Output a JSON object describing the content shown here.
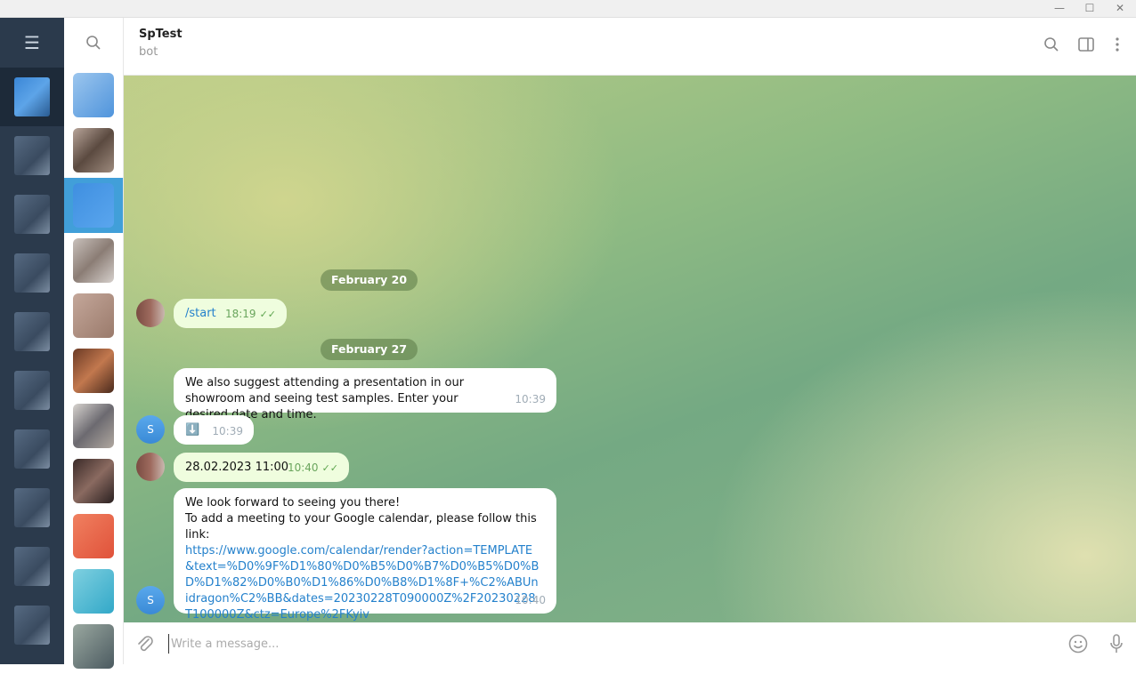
{
  "window": {
    "minimize": "—",
    "maximize": "☐",
    "close": "✕"
  },
  "header": {
    "title": "SpTest",
    "subtitle": "bot"
  },
  "messages": [
    {
      "date": "February 20"
    },
    {
      "text": "/start",
      "time": "18:19",
      "ticks": "✓✓"
    },
    {
      "date": "February 27"
    },
    {
      "text": "We also suggest attending a presentation in our showroom and seeing test samples. Enter your desired date and time.",
      "time": "10:39"
    },
    {
      "text": "⬇️",
      "time": "10:39"
    },
    {
      "text": "28.02.2023 11:00",
      "time": "10:40",
      "ticks": "✓✓"
    },
    {
      "line1": "We look forward to seeing you there!",
      "line2": "To add a meeting to your Google calendar, please follow this link:",
      "link": "https://www.google.com/calendar/render?action=TEMPLATE&text=%D0%9F%D1%80%D0%B5%D0%B7%D0%B5%D0%BD%D1%82%D0%B0%D1%86%D0%B8%D1%8F+%C2%ABUnidragon%C2%BB&dates=20230228T090000Z%2F20230228T100000Z&ctz=Europe%2FKyiv",
      "time": "10:40"
    }
  ],
  "bot_avatar_letter": "S",
  "input": {
    "placeholder": "Write a message..."
  },
  "colors": {
    "accent": "#419fd9",
    "link": "#2481cc",
    "outgoing": "#effdde"
  }
}
